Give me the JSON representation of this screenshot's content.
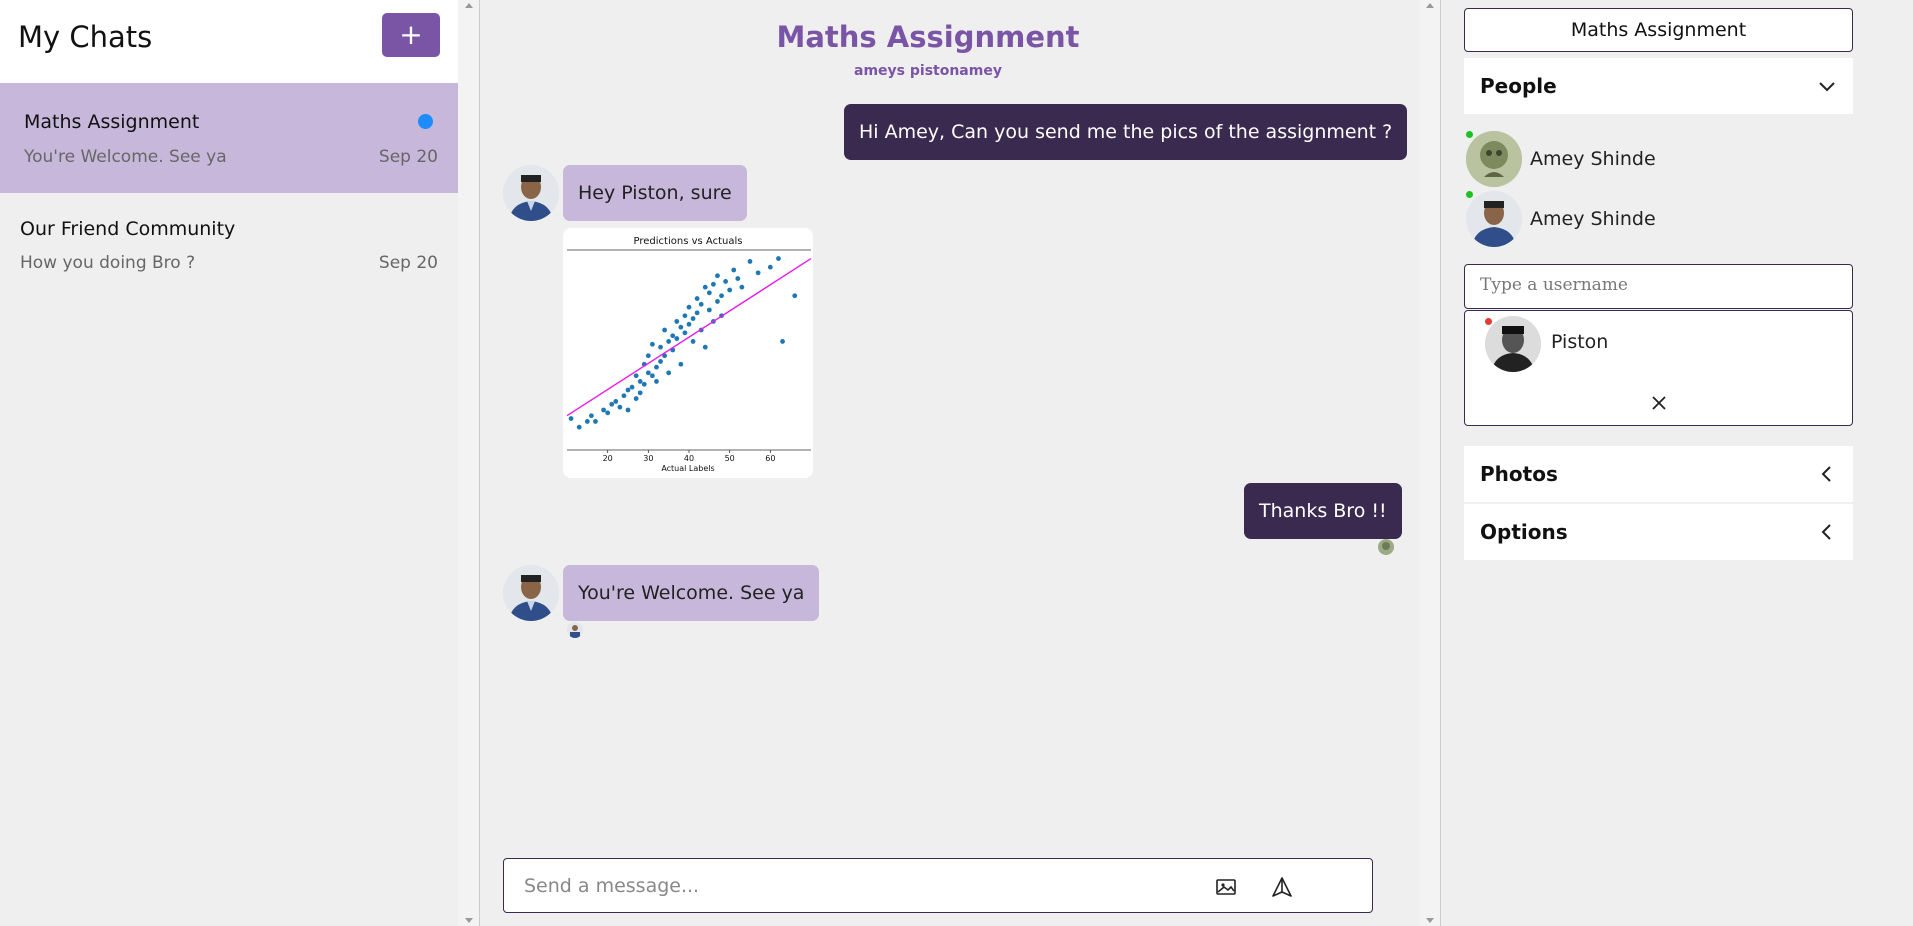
{
  "left": {
    "title": "My Chats",
    "new_label": "+",
    "chats": [
      {
        "name": "Maths Assignment",
        "last": "You're Welcome. See ya",
        "date": "Sep 20",
        "unread": true
      },
      {
        "name": "Our Friend Community",
        "last": "How you doing Bro ?",
        "date": "Sep 20",
        "unread": false
      }
    ]
  },
  "chat": {
    "title": "Maths Assignment",
    "members": "ameys pistonamey",
    "messages": [
      {
        "from": "me",
        "text": "Hi Amey, Can you send me the pics of the assignment ?"
      },
      {
        "from": "other",
        "text": "Hey Piston, sure"
      },
      {
        "from": "me",
        "text": "Thanks Bro !!"
      },
      {
        "from": "other",
        "text": "You're Welcome. See ya"
      }
    ],
    "composer_placeholder": "Send a message...",
    "image_icon": "image-icon",
    "send_icon": "send-icon"
  },
  "chart_data": {
    "type": "scatter",
    "title": "Predictions vs Actuals",
    "xlabel": "Actual Labels",
    "ylabel": "",
    "xticks": [
      "20",
      "30",
      "40",
      "50",
      "60"
    ],
    "xlim": [
      10,
      70
    ],
    "ylim": [
      0,
      70
    ],
    "series": [
      {
        "x": [
          11,
          13,
          15,
          16,
          17,
          19,
          20,
          21,
          22,
          23,
          24,
          25,
          25,
          26,
          27,
          27,
          28,
          28,
          29,
          29,
          30,
          30,
          31,
          31,
          32,
          32,
          33,
          33,
          34,
          34,
          35,
          35,
          36,
          36,
          37,
          37,
          38,
          38,
          39,
          39,
          40,
          40,
          41,
          41,
          42,
          42,
          43,
          43,
          44,
          44,
          45,
          45,
          46,
          46,
          47,
          47,
          48,
          48,
          49,
          50,
          51,
          52,
          53,
          55,
          57,
          60,
          62,
          63,
          66
        ],
        "y": [
          11,
          8,
          10,
          12,
          10,
          14,
          13,
          16,
          17,
          15,
          19,
          21,
          14,
          22,
          18,
          26,
          24,
          20,
          30,
          23,
          27,
          33,
          26,
          37,
          29,
          24,
          36,
          31,
          42,
          33,
          38,
          27,
          40,
          35,
          45,
          39,
          43,
          30,
          47,
          41,
          44,
          50,
          46,
          38,
          48,
          53,
          42,
          51,
          57,
          36,
          55,
          49,
          58,
          45,
          52,
          61,
          47,
          54,
          59,
          56,
          63,
          60,
          57,
          66,
          62,
          64,
          67,
          38,
          54
        ]
      },
      {
        "x": [
          10,
          70
        ],
        "y": [
          12,
          67
        ]
      }
    ]
  },
  "right": {
    "title": "Maths Assignment",
    "people_label": "People",
    "people": [
      {
        "name": "Amey Shinde"
      },
      {
        "name": "Amey Shinde"
      }
    ],
    "search_placeholder": "Type a username",
    "result_name": "Piston",
    "photos_label": "Photos",
    "options_label": "Options"
  }
}
